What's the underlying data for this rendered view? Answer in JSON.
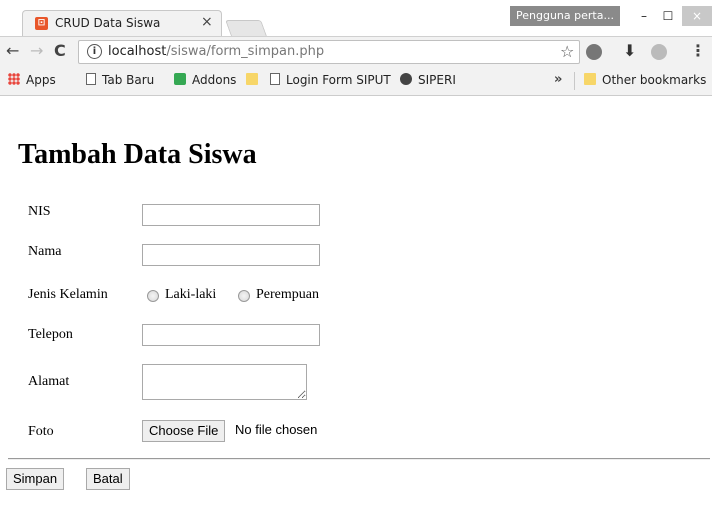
{
  "browser": {
    "tab_title": "CRUD Data Siswa",
    "tab_close": "×",
    "profile_label": "Pengguna perta...",
    "window_controls": {
      "minimize": "–",
      "maximize": "☐",
      "close": "×"
    },
    "url_host": "localhost",
    "url_path": "/siswa/form_simpan.php",
    "nav": {
      "back": "←",
      "forward": "→",
      "reload": "C"
    },
    "icons": {
      "info": "i",
      "star": "☆",
      "download": "⬇",
      "menu": "⋮"
    },
    "bookmarks": {
      "items": [
        {
          "label": "Apps",
          "icon": "apps-icon"
        },
        {
          "label": "Tab Baru",
          "icon": "page-icon"
        },
        {
          "label": "Addons",
          "icon": "puzzle-icon"
        },
        {
          "label": "",
          "icon": "folder-icon"
        },
        {
          "label": "Login Form SIPUT",
          "icon": "page-icon"
        },
        {
          "label": "SIPERI",
          "icon": "bear-icon"
        }
      ],
      "overflow": "»",
      "other": "Other bookmarks"
    }
  },
  "form": {
    "title": "Tambah Data Siswa",
    "labels": {
      "nis": "NIS",
      "nama": "Nama",
      "jenis_kelamin": "Jenis Kelamin",
      "telepon": "Telepon",
      "alamat": "Alamat",
      "foto": "Foto"
    },
    "values": {
      "nis": "",
      "nama": "",
      "telepon": "",
      "alamat": ""
    },
    "gender_options": [
      "Laki-laki",
      "Perempuan"
    ],
    "file_button": "Choose File",
    "file_status": "No file chosen",
    "submit_label": "Simpan",
    "cancel_label": "Batal"
  }
}
